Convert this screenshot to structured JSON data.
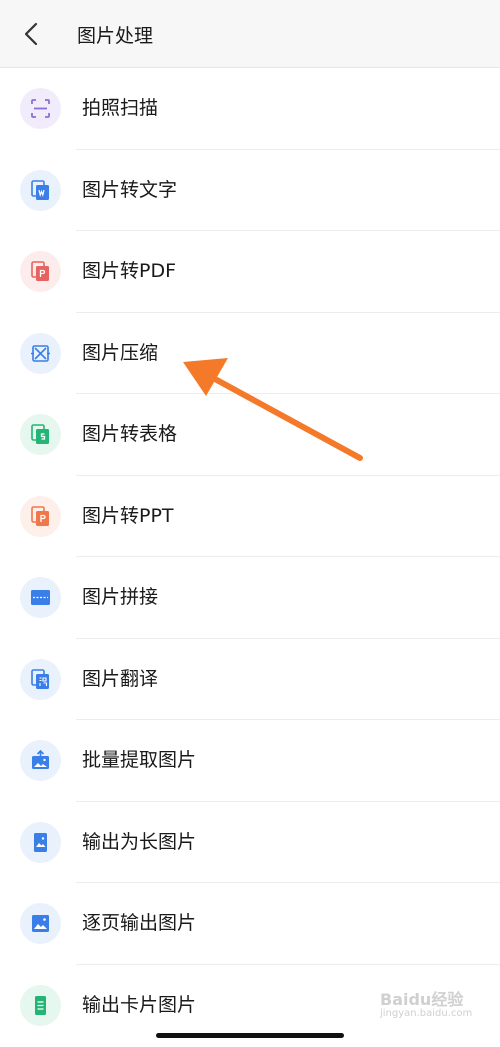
{
  "header": {
    "title": "图片处理",
    "back_label": "‹"
  },
  "items": [
    {
      "label": "拍照扫描",
      "icon": "scan-icon",
      "bg": "#f1ecfb",
      "fg": "#8b6fd8"
    },
    {
      "label": "图片转文字",
      "icon": "image-to-word-icon",
      "bg": "#e9f1fd",
      "fg": "#3a7ee8"
    },
    {
      "label": "图片转PDF",
      "icon": "image-to-pdf-icon",
      "bg": "#fdecec",
      "fg": "#e8625f"
    },
    {
      "label": "图片压缩",
      "icon": "compress-icon",
      "bg": "#e9f1fd",
      "fg": "#3a7ee8"
    },
    {
      "label": "图片转表格",
      "icon": "image-to-sheet-icon",
      "bg": "#e6f7ef",
      "fg": "#22b574"
    },
    {
      "label": "图片转PPT",
      "icon": "image-to-ppt-icon",
      "bg": "#fdefe9",
      "fg": "#f0774a"
    },
    {
      "label": "图片拼接",
      "icon": "stitch-icon",
      "bg": "#e9f1fd",
      "fg": "#3a7ee8"
    },
    {
      "label": "图片翻译",
      "icon": "translate-icon",
      "bg": "#e9f1fd",
      "fg": "#3a7ee8"
    },
    {
      "label": "批量提取图片",
      "icon": "batch-extract-icon",
      "bg": "#e9f1fd",
      "fg": "#3a7ee8"
    },
    {
      "label": "输出为长图片",
      "icon": "long-image-icon",
      "bg": "#e9f1fd",
      "fg": "#3a7ee8"
    },
    {
      "label": "逐页输出图片",
      "icon": "page-image-icon",
      "bg": "#e9f1fd",
      "fg": "#3a7ee8"
    },
    {
      "label": "输出卡片图片",
      "icon": "card-image-icon",
      "bg": "#e6f7ef",
      "fg": "#22b574"
    }
  ],
  "annotation": {
    "color": "#f47a2a"
  },
  "watermark": {
    "logo": "Baidu经验",
    "url": "jingyan.baidu.com"
  }
}
